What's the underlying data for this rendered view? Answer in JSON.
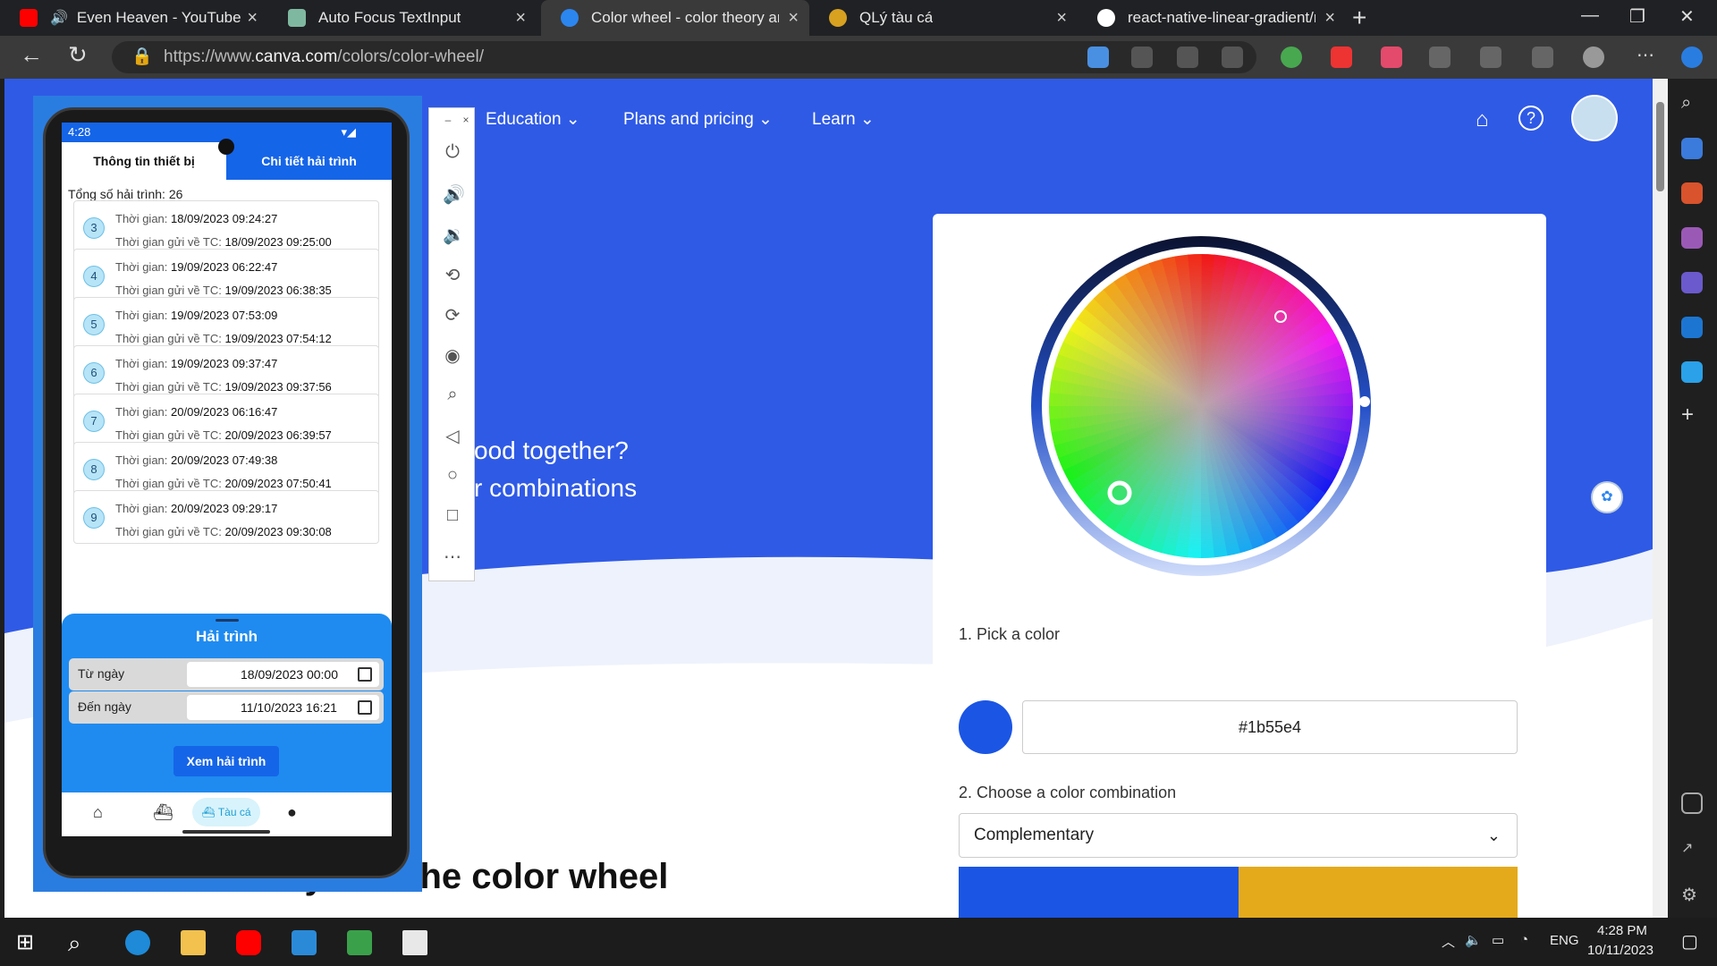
{
  "browser": {
    "tabs": [
      {
        "title": "Even Heaven - YouTube",
        "favicon": "youtube-icon",
        "color": "#ff0000"
      },
      {
        "title": "Auto Focus TextInput",
        "favicon": "chatgpt-icon",
        "color": "#7fb8a0"
      },
      {
        "title": "Color wheel - color theory and c",
        "favicon": "canva-icon",
        "color": "#2b86f0"
      },
      {
        "title": "QLý tàu cá",
        "favicon": "site-icon",
        "color": "#d8a120"
      },
      {
        "title": "react-native-linear-gradient/reac",
        "favicon": "github-icon",
        "color": "#ffffff"
      }
    ],
    "url_prefix": "https://www.",
    "url_domain": "canva.com",
    "url_path": "/colors/color-wheel/"
  },
  "page": {
    "nav": [
      "Education",
      "Plans and pricing",
      "Learn"
    ],
    "hero_line1": "ood together?",
    "hero_line2": "r combinations",
    "bottom_heading": "Color theory and the color wheel",
    "pick_label": "1. Pick a color",
    "hex_value": "#1b55e4",
    "combo_label": "2. Choose a color combination",
    "combo_value": "Complementary",
    "palette": [
      "#1b55e4",
      "#e4aa1b"
    ]
  },
  "app": {
    "status_time": "4:28",
    "tab_device": "Thông tin thiết bị",
    "tab_trips": "Chi tiết hải trình",
    "total_label": "Tổng số hải trình: 26",
    "time_label": "Thời gian:",
    "sent_label": "Thời gian gửi về TC:",
    "items": [
      {
        "n": "3",
        "time": "18/09/2023 09:24:27",
        "sent": "18/09/2023 09:25:00"
      },
      {
        "n": "4",
        "time": "19/09/2023 06:22:47",
        "sent": "19/09/2023 06:38:35"
      },
      {
        "n": "5",
        "time": "19/09/2023 07:53:09",
        "sent": "19/09/2023 07:54:12"
      },
      {
        "n": "6",
        "time": "19/09/2023 09:37:47",
        "sent": "19/09/2023 09:37:56"
      },
      {
        "n": "7",
        "time": "20/09/2023 06:16:47",
        "sent": "20/09/2023 06:39:57"
      },
      {
        "n": "8",
        "time": "20/09/2023 07:49:38",
        "sent": "20/09/2023 07:50:41"
      },
      {
        "n": "9",
        "time": "20/09/2023 09:29:17",
        "sent": "20/09/2023 09:30:08"
      }
    ],
    "sheet_title": "Hải trình",
    "from_label": "Từ ngày",
    "from_value": "18/09/2023 00:00",
    "to_label": "Đến ngày",
    "to_value": "11/10/2023 16:21",
    "view_button": "Xem hải trình",
    "nav_active": "Tàu cá"
  },
  "taskbar": {
    "lang": "ENG",
    "time": "4:28 PM",
    "date": "10/11/2023"
  }
}
